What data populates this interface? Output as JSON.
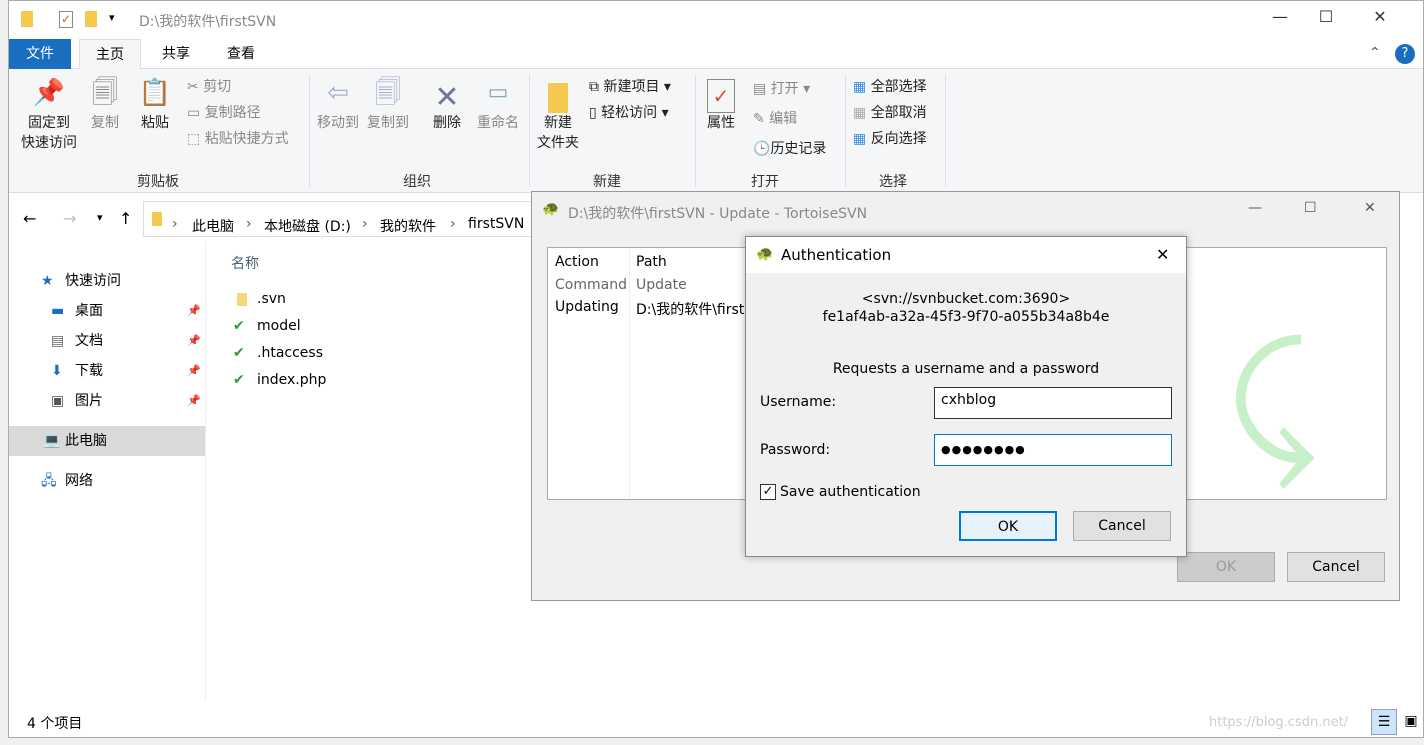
{
  "explorer": {
    "title": "D:\\我的软件\\firstSVN",
    "tabs": [
      "文件",
      "主页",
      "共享",
      "查看"
    ],
    "clipboard": {
      "pin": "固定到\n快速访问",
      "copy": "复制",
      "paste": "粘贴",
      "cut": "剪切",
      "copy_path": "复制路径",
      "paste_shortcut": "粘贴快捷方式",
      "label": "剪贴板"
    },
    "organize": {
      "move_to": "移动到",
      "copy_to": "复制到",
      "delete": "删除",
      "rename": "重命名",
      "label": "组织"
    },
    "new": {
      "new_folder": "新建\n文件夹",
      "new_item": "新建项目",
      "easy_access": "轻松访问",
      "label": "新建"
    },
    "open": {
      "properties": "属性",
      "open": "打开",
      "edit": "编辑",
      "history": "历史记录",
      "label": "打开"
    },
    "select": {
      "select_all": "全部选择",
      "select_none": "全部取消",
      "invert": "反向选择",
      "label": "选择"
    },
    "breadcrumb": [
      "此电脑",
      "本地磁盘 (D:)",
      "我的软件",
      "firstSVN"
    ],
    "nav": [
      {
        "label": "快速访问"
      },
      {
        "label": "桌面"
      },
      {
        "label": "文档"
      },
      {
        "label": "下载"
      },
      {
        "label": "图片"
      },
      {
        "label": "此电脑"
      },
      {
        "label": "网络"
      }
    ],
    "column_name": "名称",
    "files": [
      ".svn",
      "model",
      ".htaccess",
      "index.php"
    ],
    "status": "4 个项目",
    "watermark": "https://blog.csdn.net/"
  },
  "svn": {
    "title": "D:\\我的软件\\firstSVN - Update - TortoiseSVN",
    "columns": [
      "Action",
      "Path"
    ],
    "rows": [
      [
        "Command",
        "Update"
      ],
      [
        "Updating",
        "D:\\我的软件\\first"
      ]
    ],
    "ok": "OK",
    "cancel": "Cancel"
  },
  "auth": {
    "title": "Authentication",
    "realm1": "<svn://svnbucket.com:3690>",
    "realm2": "fe1af4ab-a32a-45f3-9f70-a055b34a8b4e",
    "prompt": "Requests a username and a password",
    "username_label": "Username:",
    "username": "cxhblog",
    "password_label": "Password:",
    "password": "●●●●●●●●",
    "save_label": "Save authentication",
    "save_checked": true,
    "ok": "OK",
    "cancel": "Cancel"
  },
  "colors": {
    "accent": "#1a6ec0",
    "focus": "#0078d7"
  }
}
